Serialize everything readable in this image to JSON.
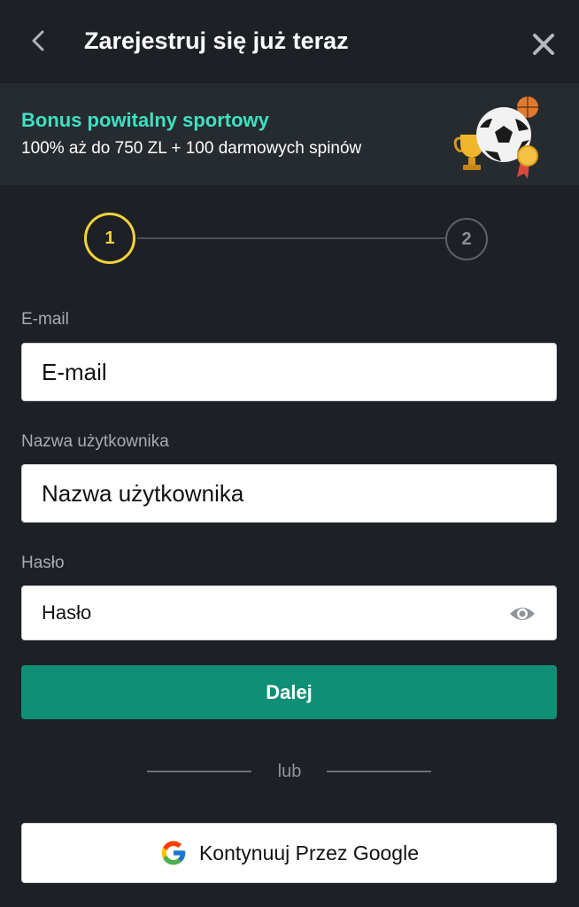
{
  "header": {
    "title": "Zarejestruj się już teraz",
    "back_icon": "chevron-left-icon",
    "close_icon": "close-icon"
  },
  "banner": {
    "title": "Bonus powitalny sportowy",
    "subtitle": "100% aż do 750 ZL + 100 darmowych spinów",
    "art_icon": "sports-trophy-ball-icon"
  },
  "stepper": {
    "steps": [
      {
        "label": "1",
        "state": "active"
      },
      {
        "label": "2",
        "state": "inactive"
      }
    ]
  },
  "form": {
    "email": {
      "label": "E-mail",
      "placeholder": "E-mail",
      "value": ""
    },
    "username": {
      "label": "Nazwa użytkownika",
      "placeholder": "Nazwa użytkownika",
      "value": ""
    },
    "password": {
      "label": "Hasło",
      "placeholder": "Hasło",
      "value": "",
      "toggle_icon": "eye-icon"
    },
    "submit_label": "Dalej"
  },
  "divider": {
    "text": "lub"
  },
  "google": {
    "label": "Kontynuuj Przez Google",
    "icon": "google-icon"
  },
  "colors": {
    "background": "#1d2125",
    "banner_bg": "#262b30",
    "accent_teal": "#3fe0c2",
    "step_active": "#f5d13b",
    "primary_button": "#0f8f75"
  }
}
